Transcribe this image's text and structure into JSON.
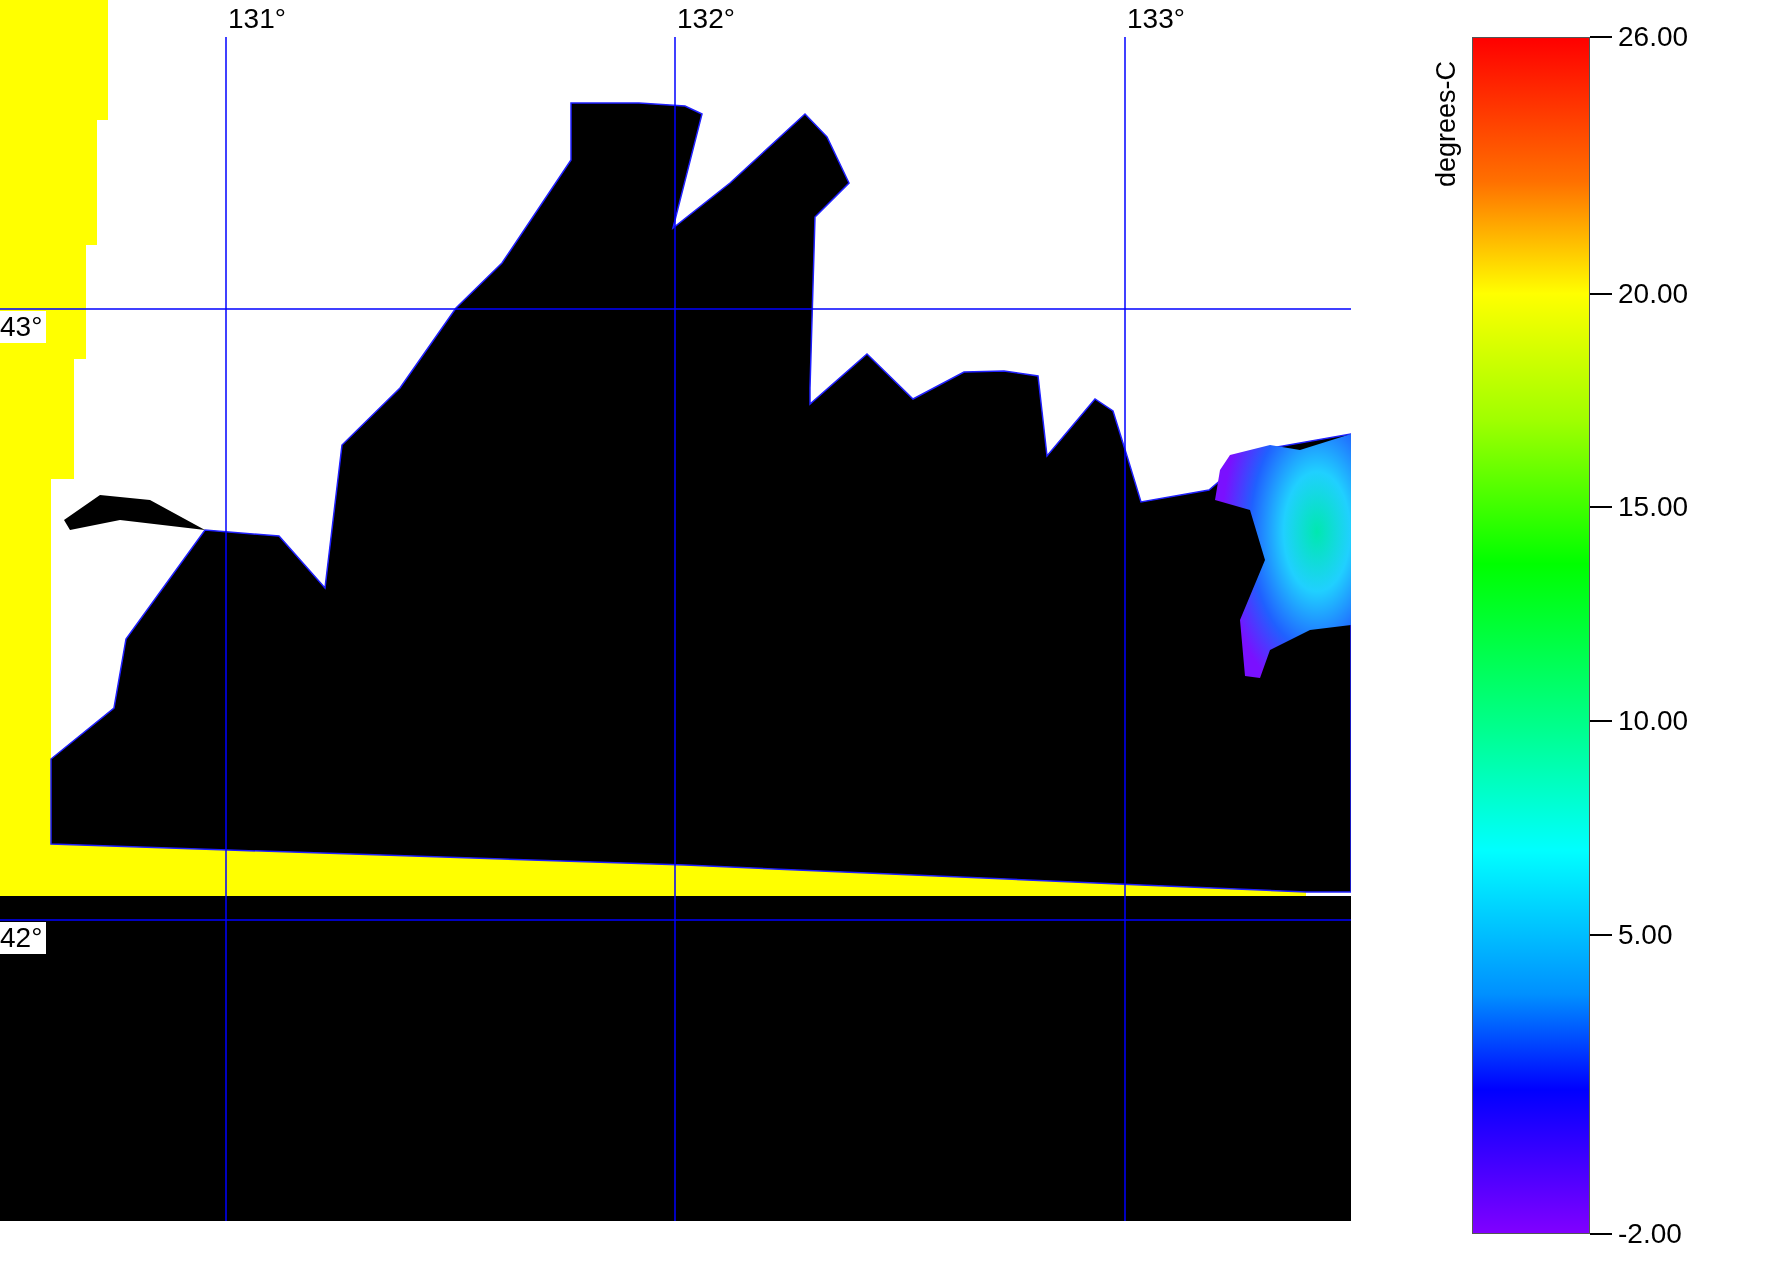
{
  "map": {
    "longitude_labels": [
      "131°",
      "132°",
      "133°"
    ],
    "latitude_labels": [
      "43°",
      "42°"
    ]
  },
  "colorbar": {
    "title": "degrees-C",
    "tick_labels": [
      "26.00",
      "20.00",
      "15.00",
      "10.00",
      "5.00",
      "-2.00"
    ]
  }
}
